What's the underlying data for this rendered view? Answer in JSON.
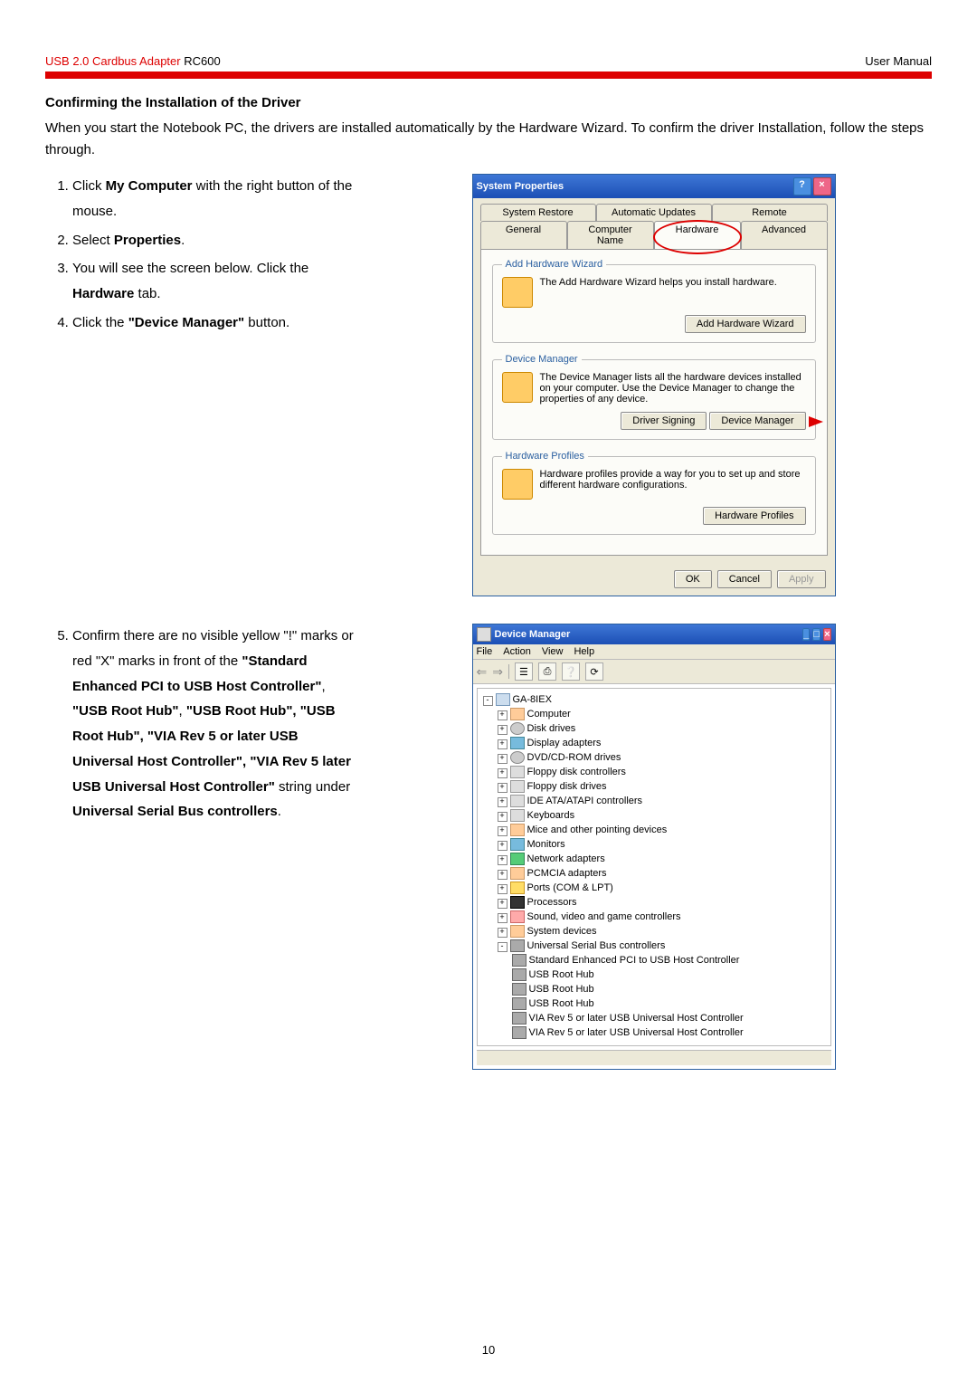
{
  "header": {
    "product_red": "USB 2.0 Cardbus Adapter",
    "product_black": "RC600",
    "right": "User Manual"
  },
  "section_title": "Confirming the Installation of the Driver",
  "intro": "When you start the Notebook PC, the drivers are installed automatically by the Hardware Wizard. To confirm the driver Installation, follow the steps through.",
  "steps_a": [
    {
      "pre": "Click ",
      "b": "My Computer",
      "post": " with the right button of the mouse."
    },
    {
      "pre": "Select ",
      "b": "Properties",
      "post": "."
    },
    {
      "pre": "You will see the screen below. Click the ",
      "b": "Hardware",
      "post": " tab."
    },
    {
      "pre": "Click the ",
      "b": "\"Device Manager\"",
      "post": " button."
    }
  ],
  "sys_props": {
    "title": "System Properties",
    "tabs_row1": [
      "System Restore",
      "Automatic Updates",
      "Remote"
    ],
    "tabs_row2": [
      "General",
      "Computer Name",
      "Hardware",
      "Advanced"
    ],
    "group1": {
      "legend": "Add Hardware Wizard",
      "text": "The Add Hardware Wizard helps you install hardware.",
      "btn": "Add Hardware Wizard"
    },
    "group2": {
      "legend": "Device Manager",
      "text": "The Device Manager lists all the hardware devices installed on your computer. Use the Device Manager to change the properties of any device.",
      "btn1": "Driver Signing",
      "btn2": "Device Manager"
    },
    "group3": {
      "legend": "Hardware Profiles",
      "text": "Hardware profiles provide a way for you to set up and store different hardware configurations.",
      "btn": "Hardware Profiles"
    },
    "footer": {
      "ok": "OK",
      "cancel": "Cancel",
      "apply": "Apply"
    }
  },
  "step5": {
    "num": "5.",
    "t1": "Confirm there are no visible yellow \"!\" marks or red \"X\" marks in front of the ",
    "b1": "\"Standard Enhanced PCI to USB Host Controller\"",
    "c1": ", ",
    "b2": "\"USB Root Hub\"",
    "c2": ", ",
    "b3": "\"USB Root Hub\", \"USB Root Hub\", \"VIA Rev 5 or later USB Universal Host Controller\", \"VIA Rev 5 later USB Universal Host Controller\"",
    "t2": " string under ",
    "b4": "Universal Serial Bus controllers",
    "t3": "."
  },
  "dm": {
    "title": "Device Manager",
    "menu": [
      "File",
      "Action",
      "View",
      "Help"
    ],
    "root": "GA-8IEX",
    "nodes": [
      "Computer",
      "Disk drives",
      "Display adapters",
      "DVD/CD-ROM drives",
      "Floppy disk controllers",
      "Floppy disk drives",
      "IDE ATA/ATAPI controllers",
      "Keyboards",
      "Mice and other pointing devices",
      "Monitors",
      "Network adapters",
      "PCMCIA adapters",
      "Ports (COM & LPT)",
      "Processors",
      "Sound, video and game controllers",
      "System devices"
    ],
    "usb_parent": "Universal Serial Bus controllers",
    "usb_children": [
      "Standard Enhanced PCI to USB Host Controller",
      "USB Root Hub",
      "USB Root Hub",
      "USB Root Hub",
      "VIA Rev 5 or later USB Universal Host Controller",
      "VIA Rev 5 or later USB Universal Host Controller"
    ]
  },
  "page_num": "10"
}
